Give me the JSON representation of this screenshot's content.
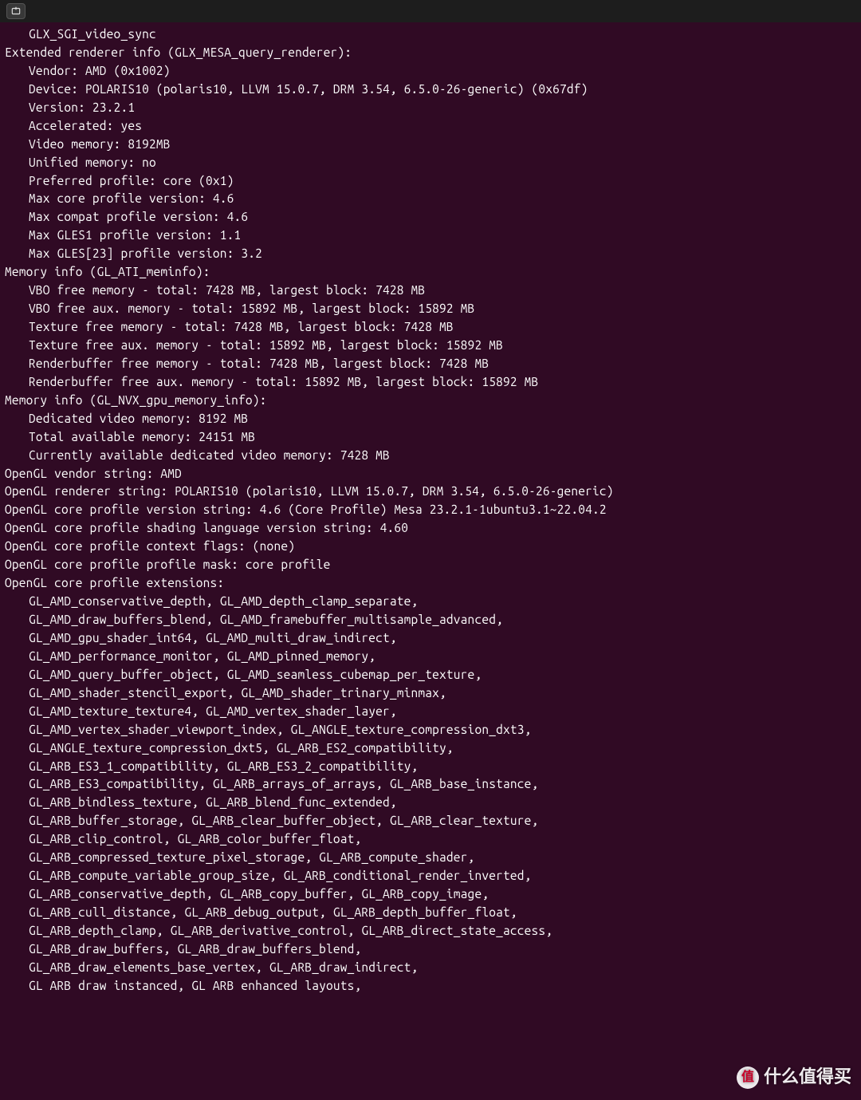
{
  "watermark": {
    "badge": "值",
    "text": "什么值得买"
  },
  "terminal": {
    "lines": [
      {
        "indent": 1,
        "text": "GLX_SGI_video_sync"
      },
      {
        "indent": 0,
        "text": "Extended renderer info (GLX_MESA_query_renderer):"
      },
      {
        "indent": 1,
        "text": "Vendor: AMD (0x1002)"
      },
      {
        "indent": 1,
        "text": "Device: POLARIS10 (polaris10, LLVM 15.0.7, DRM 3.54, 6.5.0-26-generic) (0x67df)"
      },
      {
        "indent": 1,
        "text": "Version: 23.2.1"
      },
      {
        "indent": 1,
        "text": "Accelerated: yes"
      },
      {
        "indent": 1,
        "text": "Video memory: 8192MB"
      },
      {
        "indent": 1,
        "text": "Unified memory: no"
      },
      {
        "indent": 1,
        "text": "Preferred profile: core (0x1)"
      },
      {
        "indent": 1,
        "text": "Max core profile version: 4.6"
      },
      {
        "indent": 1,
        "text": "Max compat profile version: 4.6"
      },
      {
        "indent": 1,
        "text": "Max GLES1 profile version: 1.1"
      },
      {
        "indent": 1,
        "text": "Max GLES[23] profile version: 3.2"
      },
      {
        "indent": 0,
        "text": "Memory info (GL_ATI_meminfo):"
      },
      {
        "indent": 1,
        "text": "VBO free memory - total: 7428 MB, largest block: 7428 MB"
      },
      {
        "indent": 1,
        "text": "VBO free aux. memory - total: 15892 MB, largest block: 15892 MB"
      },
      {
        "indent": 1,
        "text": "Texture free memory - total: 7428 MB, largest block: 7428 MB"
      },
      {
        "indent": 1,
        "text": "Texture free aux. memory - total: 15892 MB, largest block: 15892 MB"
      },
      {
        "indent": 1,
        "text": "Renderbuffer free memory - total: 7428 MB, largest block: 7428 MB"
      },
      {
        "indent": 1,
        "text": "Renderbuffer free aux. memory - total: 15892 MB, largest block: 15892 MB"
      },
      {
        "indent": 0,
        "text": "Memory info (GL_NVX_gpu_memory_info):"
      },
      {
        "indent": 1,
        "text": "Dedicated video memory: 8192 MB"
      },
      {
        "indent": 1,
        "text": "Total available memory: 24151 MB"
      },
      {
        "indent": 1,
        "text": "Currently available dedicated video memory: 7428 MB"
      },
      {
        "indent": 0,
        "text": "OpenGL vendor string: AMD"
      },
      {
        "indent": 0,
        "text": "OpenGL renderer string: POLARIS10 (polaris10, LLVM 15.0.7, DRM 3.54, 6.5.0-26-generic)"
      },
      {
        "indent": 0,
        "text": "OpenGL core profile version string: 4.6 (Core Profile) Mesa 23.2.1-1ubuntu3.1~22.04.2"
      },
      {
        "indent": 0,
        "text": "OpenGL core profile shading language version string: 4.60"
      },
      {
        "indent": 0,
        "text": "OpenGL core profile context flags: (none)"
      },
      {
        "indent": 0,
        "text": "OpenGL core profile profile mask: core profile"
      },
      {
        "indent": 0,
        "text": "OpenGL core profile extensions:"
      },
      {
        "indent": 1,
        "text": "GL_AMD_conservative_depth, GL_AMD_depth_clamp_separate,"
      },
      {
        "indent": 1,
        "text": "GL_AMD_draw_buffers_blend, GL_AMD_framebuffer_multisample_advanced,"
      },
      {
        "indent": 1,
        "text": "GL_AMD_gpu_shader_int64, GL_AMD_multi_draw_indirect,"
      },
      {
        "indent": 1,
        "text": "GL_AMD_performance_monitor, GL_AMD_pinned_memory,"
      },
      {
        "indent": 1,
        "text": "GL_AMD_query_buffer_object, GL_AMD_seamless_cubemap_per_texture,"
      },
      {
        "indent": 1,
        "text": "GL_AMD_shader_stencil_export, GL_AMD_shader_trinary_minmax,"
      },
      {
        "indent": 1,
        "text": "GL_AMD_texture_texture4, GL_AMD_vertex_shader_layer,"
      },
      {
        "indent": 1,
        "text": "GL_AMD_vertex_shader_viewport_index, GL_ANGLE_texture_compression_dxt3,"
      },
      {
        "indent": 1,
        "text": "GL_ANGLE_texture_compression_dxt5, GL_ARB_ES2_compatibility,"
      },
      {
        "indent": 1,
        "text": "GL_ARB_ES3_1_compatibility, GL_ARB_ES3_2_compatibility,"
      },
      {
        "indent": 1,
        "text": "GL_ARB_ES3_compatibility, GL_ARB_arrays_of_arrays, GL_ARB_base_instance,"
      },
      {
        "indent": 1,
        "text": "GL_ARB_bindless_texture, GL_ARB_blend_func_extended,"
      },
      {
        "indent": 1,
        "text": "GL_ARB_buffer_storage, GL_ARB_clear_buffer_object, GL_ARB_clear_texture,"
      },
      {
        "indent": 1,
        "text": "GL_ARB_clip_control, GL_ARB_color_buffer_float,"
      },
      {
        "indent": 1,
        "text": "GL_ARB_compressed_texture_pixel_storage, GL_ARB_compute_shader,"
      },
      {
        "indent": 1,
        "text": "GL_ARB_compute_variable_group_size, GL_ARB_conditional_render_inverted,"
      },
      {
        "indent": 1,
        "text": "GL_ARB_conservative_depth, GL_ARB_copy_buffer, GL_ARB_copy_image,"
      },
      {
        "indent": 1,
        "text": "GL_ARB_cull_distance, GL_ARB_debug_output, GL_ARB_depth_buffer_float,"
      },
      {
        "indent": 1,
        "text": "GL_ARB_depth_clamp, GL_ARB_derivative_control, GL_ARB_direct_state_access,"
      },
      {
        "indent": 1,
        "text": "GL_ARB_draw_buffers, GL_ARB_draw_buffers_blend,"
      },
      {
        "indent": 1,
        "text": "GL_ARB_draw_elements_base_vertex, GL_ARB_draw_indirect,"
      },
      {
        "indent": 1,
        "text": "GL ARB draw instanced, GL ARB enhanced layouts,"
      }
    ]
  }
}
